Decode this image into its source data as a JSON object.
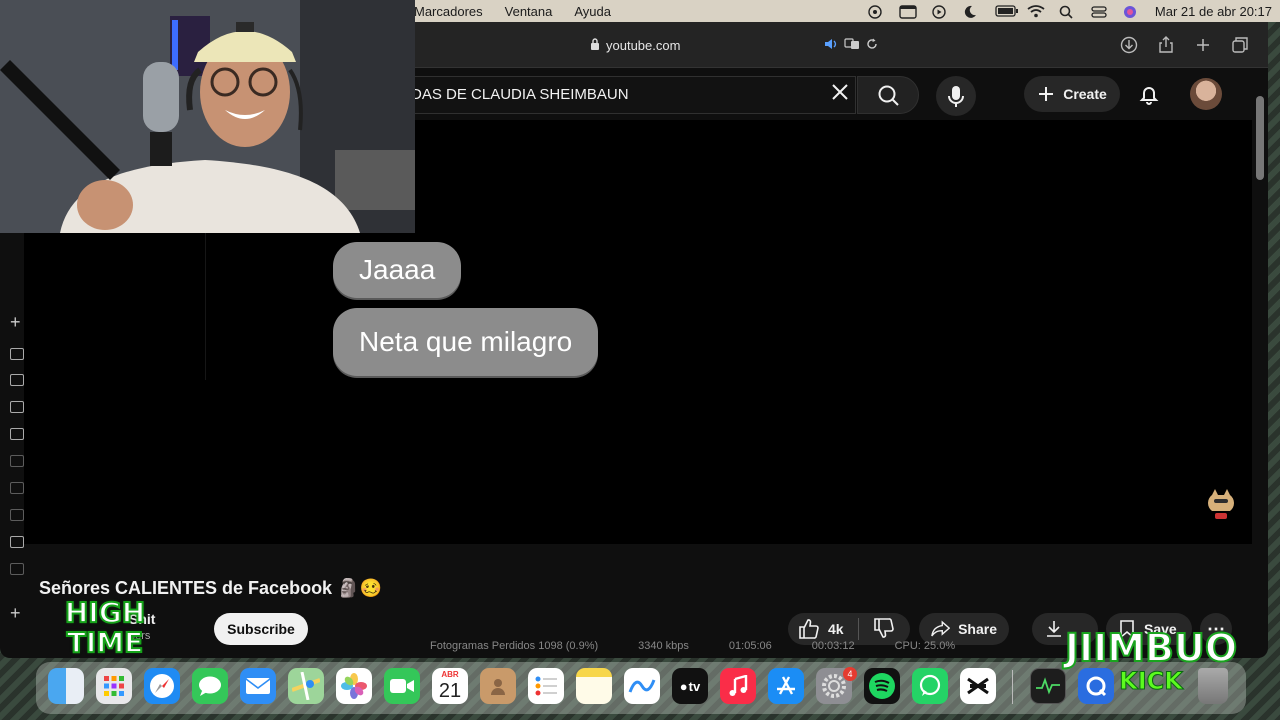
{
  "menubar": {
    "items": [
      "Marcadores",
      "Ventana",
      "Ayuda"
    ],
    "datetime": "Mar 21 de abr  20:17"
  },
  "browser": {
    "url": "youtube.com"
  },
  "youtube": {
    "search_query": "DAS DE CLAUDIA SHEIMBAUN",
    "create_label": "Create",
    "video_title": "Señores CALIENTES de Facebook 🗿🥴",
    "channel_name": "Shit",
    "subscribers": "bers",
    "subscribe_label": "Subscribe",
    "likes": "4k",
    "share_label": "Share",
    "save_label": "Save"
  },
  "video": {
    "messages": [
      "Jaaaa",
      "Neta que milagro"
    ]
  },
  "stats_bar": {
    "frames": "Fotogramas Perdidos 1098 (0.9%)",
    "bitrate": "3340 kbps",
    "time1": "01:05:06",
    "time2": "00:03:12",
    "cpu": "CPU: 25.0%"
  },
  "dock": {
    "calendar_month": "ABR",
    "calendar_day": "21",
    "settings_badge": "4",
    "appletv_label": "tv"
  },
  "overlays": {
    "high_time": [
      "HIGH",
      "TIME"
    ],
    "brand_top": "JIIMBUO",
    "brand_bottom": "KICK"
  }
}
